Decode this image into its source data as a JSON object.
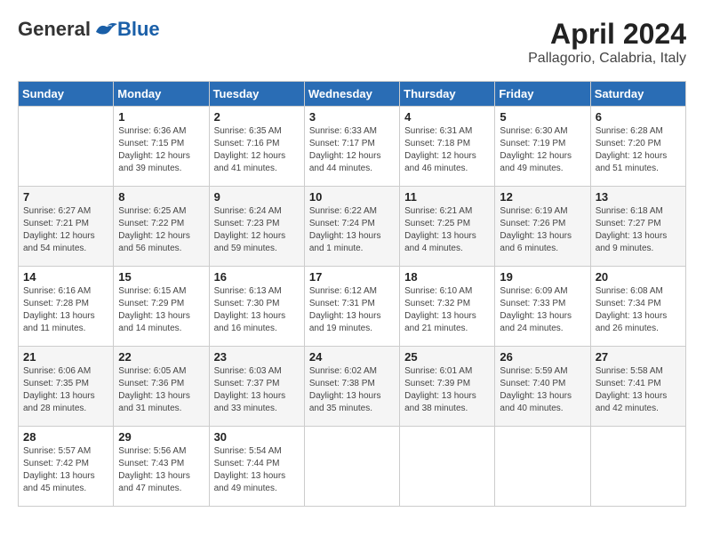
{
  "logo": {
    "general": "General",
    "blue": "Blue"
  },
  "title": {
    "month_year": "April 2024",
    "location": "Pallagorio, Calabria, Italy"
  },
  "days_of_week": [
    "Sunday",
    "Monday",
    "Tuesday",
    "Wednesday",
    "Thursday",
    "Friday",
    "Saturday"
  ],
  "weeks": [
    [
      {
        "day": "",
        "sunrise": "",
        "sunset": "",
        "daylight": ""
      },
      {
        "day": "1",
        "sunrise": "Sunrise: 6:36 AM",
        "sunset": "Sunset: 7:15 PM",
        "daylight": "Daylight: 12 hours and 39 minutes."
      },
      {
        "day": "2",
        "sunrise": "Sunrise: 6:35 AM",
        "sunset": "Sunset: 7:16 PM",
        "daylight": "Daylight: 12 hours and 41 minutes."
      },
      {
        "day": "3",
        "sunrise": "Sunrise: 6:33 AM",
        "sunset": "Sunset: 7:17 PM",
        "daylight": "Daylight: 12 hours and 44 minutes."
      },
      {
        "day": "4",
        "sunrise": "Sunrise: 6:31 AM",
        "sunset": "Sunset: 7:18 PM",
        "daylight": "Daylight: 12 hours and 46 minutes."
      },
      {
        "day": "5",
        "sunrise": "Sunrise: 6:30 AM",
        "sunset": "Sunset: 7:19 PM",
        "daylight": "Daylight: 12 hours and 49 minutes."
      },
      {
        "day": "6",
        "sunrise": "Sunrise: 6:28 AM",
        "sunset": "Sunset: 7:20 PM",
        "daylight": "Daylight: 12 hours and 51 minutes."
      }
    ],
    [
      {
        "day": "7",
        "sunrise": "Sunrise: 6:27 AM",
        "sunset": "Sunset: 7:21 PM",
        "daylight": "Daylight: 12 hours and 54 minutes."
      },
      {
        "day": "8",
        "sunrise": "Sunrise: 6:25 AM",
        "sunset": "Sunset: 7:22 PM",
        "daylight": "Daylight: 12 hours and 56 minutes."
      },
      {
        "day": "9",
        "sunrise": "Sunrise: 6:24 AM",
        "sunset": "Sunset: 7:23 PM",
        "daylight": "Daylight: 12 hours and 59 minutes."
      },
      {
        "day": "10",
        "sunrise": "Sunrise: 6:22 AM",
        "sunset": "Sunset: 7:24 PM",
        "daylight": "Daylight: 13 hours and 1 minute."
      },
      {
        "day": "11",
        "sunrise": "Sunrise: 6:21 AM",
        "sunset": "Sunset: 7:25 PM",
        "daylight": "Daylight: 13 hours and 4 minutes."
      },
      {
        "day": "12",
        "sunrise": "Sunrise: 6:19 AM",
        "sunset": "Sunset: 7:26 PM",
        "daylight": "Daylight: 13 hours and 6 minutes."
      },
      {
        "day": "13",
        "sunrise": "Sunrise: 6:18 AM",
        "sunset": "Sunset: 7:27 PM",
        "daylight": "Daylight: 13 hours and 9 minutes."
      }
    ],
    [
      {
        "day": "14",
        "sunrise": "Sunrise: 6:16 AM",
        "sunset": "Sunset: 7:28 PM",
        "daylight": "Daylight: 13 hours and 11 minutes."
      },
      {
        "day": "15",
        "sunrise": "Sunrise: 6:15 AM",
        "sunset": "Sunset: 7:29 PM",
        "daylight": "Daylight: 13 hours and 14 minutes."
      },
      {
        "day": "16",
        "sunrise": "Sunrise: 6:13 AM",
        "sunset": "Sunset: 7:30 PM",
        "daylight": "Daylight: 13 hours and 16 minutes."
      },
      {
        "day": "17",
        "sunrise": "Sunrise: 6:12 AM",
        "sunset": "Sunset: 7:31 PM",
        "daylight": "Daylight: 13 hours and 19 minutes."
      },
      {
        "day": "18",
        "sunrise": "Sunrise: 6:10 AM",
        "sunset": "Sunset: 7:32 PM",
        "daylight": "Daylight: 13 hours and 21 minutes."
      },
      {
        "day": "19",
        "sunrise": "Sunrise: 6:09 AM",
        "sunset": "Sunset: 7:33 PM",
        "daylight": "Daylight: 13 hours and 24 minutes."
      },
      {
        "day": "20",
        "sunrise": "Sunrise: 6:08 AM",
        "sunset": "Sunset: 7:34 PM",
        "daylight": "Daylight: 13 hours and 26 minutes."
      }
    ],
    [
      {
        "day": "21",
        "sunrise": "Sunrise: 6:06 AM",
        "sunset": "Sunset: 7:35 PM",
        "daylight": "Daylight: 13 hours and 28 minutes."
      },
      {
        "day": "22",
        "sunrise": "Sunrise: 6:05 AM",
        "sunset": "Sunset: 7:36 PM",
        "daylight": "Daylight: 13 hours and 31 minutes."
      },
      {
        "day": "23",
        "sunrise": "Sunrise: 6:03 AM",
        "sunset": "Sunset: 7:37 PM",
        "daylight": "Daylight: 13 hours and 33 minutes."
      },
      {
        "day": "24",
        "sunrise": "Sunrise: 6:02 AM",
        "sunset": "Sunset: 7:38 PM",
        "daylight": "Daylight: 13 hours and 35 minutes."
      },
      {
        "day": "25",
        "sunrise": "Sunrise: 6:01 AM",
        "sunset": "Sunset: 7:39 PM",
        "daylight": "Daylight: 13 hours and 38 minutes."
      },
      {
        "day": "26",
        "sunrise": "Sunrise: 5:59 AM",
        "sunset": "Sunset: 7:40 PM",
        "daylight": "Daylight: 13 hours and 40 minutes."
      },
      {
        "day": "27",
        "sunrise": "Sunrise: 5:58 AM",
        "sunset": "Sunset: 7:41 PM",
        "daylight": "Daylight: 13 hours and 42 minutes."
      }
    ],
    [
      {
        "day": "28",
        "sunrise": "Sunrise: 5:57 AM",
        "sunset": "Sunset: 7:42 PM",
        "daylight": "Daylight: 13 hours and 45 minutes."
      },
      {
        "day": "29",
        "sunrise": "Sunrise: 5:56 AM",
        "sunset": "Sunset: 7:43 PM",
        "daylight": "Daylight: 13 hours and 47 minutes."
      },
      {
        "day": "30",
        "sunrise": "Sunrise: 5:54 AM",
        "sunset": "Sunset: 7:44 PM",
        "daylight": "Daylight: 13 hours and 49 minutes."
      },
      {
        "day": "",
        "sunrise": "",
        "sunset": "",
        "daylight": ""
      },
      {
        "day": "",
        "sunrise": "",
        "sunset": "",
        "daylight": ""
      },
      {
        "day": "",
        "sunrise": "",
        "sunset": "",
        "daylight": ""
      },
      {
        "day": "",
        "sunrise": "",
        "sunset": "",
        "daylight": ""
      }
    ]
  ]
}
